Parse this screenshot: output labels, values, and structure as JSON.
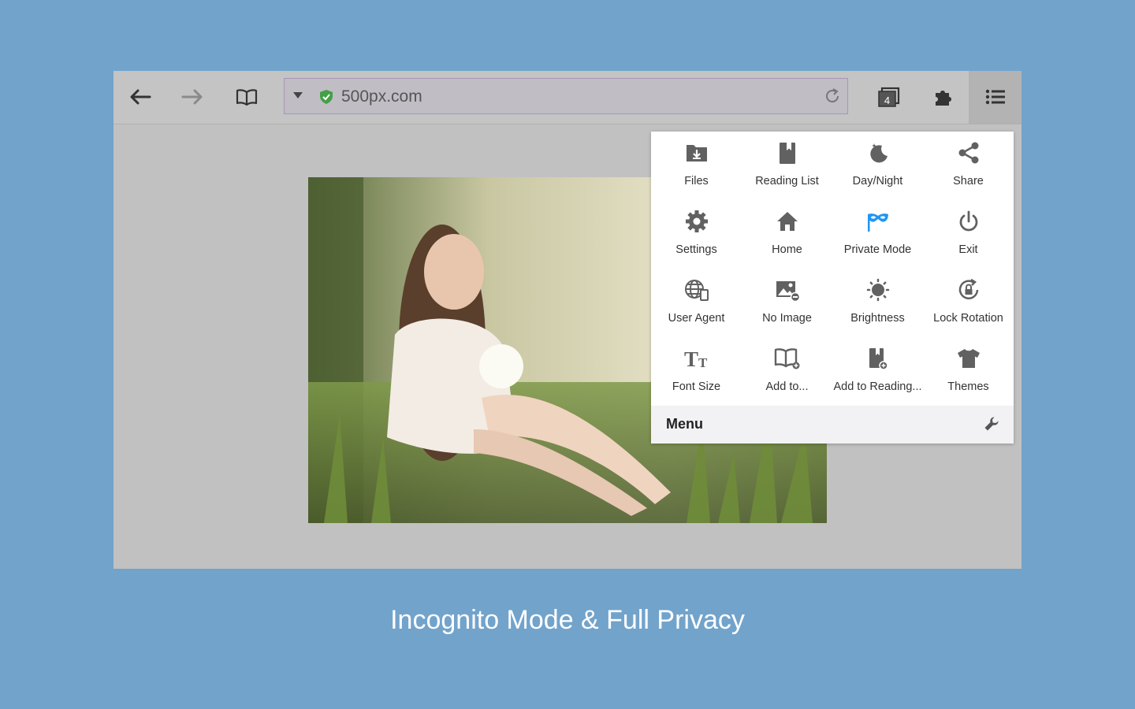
{
  "browser": {
    "address": "500px.com",
    "tab_count": "4"
  },
  "menu": {
    "title": "Menu",
    "items": [
      {
        "label": "Files",
        "icon": "folder-download-icon"
      },
      {
        "label": "Reading List",
        "icon": "bookmark-icon"
      },
      {
        "label": "Day/Night",
        "icon": "moon-icon"
      },
      {
        "label": "Share",
        "icon": "share-icon"
      },
      {
        "label": "Settings",
        "icon": "gear-icon"
      },
      {
        "label": "Home",
        "icon": "home-icon"
      },
      {
        "label": "Private Mode",
        "icon": "mask-icon"
      },
      {
        "label": "Exit",
        "icon": "power-icon"
      },
      {
        "label": "User Agent",
        "icon": "globe-device-icon"
      },
      {
        "label": "No Image",
        "icon": "image-off-icon"
      },
      {
        "label": "Brightness",
        "icon": "sun-icon"
      },
      {
        "label": "Lock Rotation",
        "icon": "lock-rotation-icon"
      },
      {
        "label": "Font Size",
        "icon": "font-size-icon"
      },
      {
        "label": "Add to...",
        "icon": "book-add-icon"
      },
      {
        "label": "Add to Reading...",
        "icon": "bookmark-add-icon"
      },
      {
        "label": "Themes",
        "icon": "shirt-icon"
      }
    ]
  },
  "caption": "Incognito Mode & Full Privacy",
  "colors": {
    "background": "#72a3cb",
    "private_mode_accent": "#2196f3",
    "secure_green": "#43a047"
  }
}
